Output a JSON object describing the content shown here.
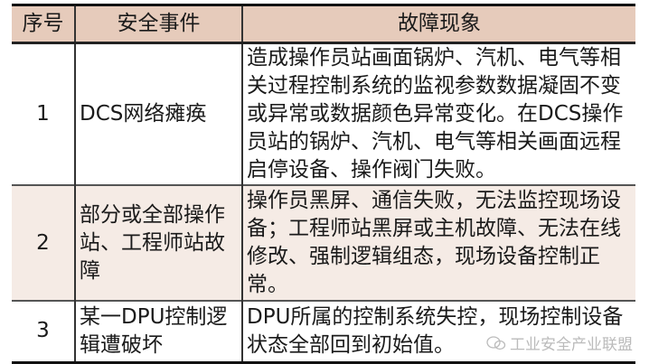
{
  "table": {
    "headers": [
      "序号",
      "安全事件",
      "故障现象"
    ],
    "rows": [
      {
        "no": "1",
        "event": "DCS网络瘫痪",
        "symptom": "造成操作员站画面锅炉、汽机、电气等相关过程控制系统的监视参数数据凝固不变或异常或数据颜色异常变化。在DCS操作员站的锅炉、汽机、电气等相关画面远程启停设备、操作阀门失败。"
      },
      {
        "no": "2",
        "event": "部分或全部操作站、工程师站故障",
        "symptom": "操作员黑屏、通信失败，无法监控现场设备；工程师站黑屏或主机故障、无法在线修改、强制逻辑组态，现场设备控制正常。"
      },
      {
        "no": "3",
        "event": "某一DPU控制逻辑遭破坏",
        "symptom": "DPU所属的控制系统失控，现场控制设备状态全部回到初始值。"
      }
    ],
    "header_color": "#e6cbbb",
    "shaded_row_color": "#f5ebe5"
  },
  "watermark": {
    "text": "工业安全产业联盟",
    "icon": "wechat-icon"
  }
}
